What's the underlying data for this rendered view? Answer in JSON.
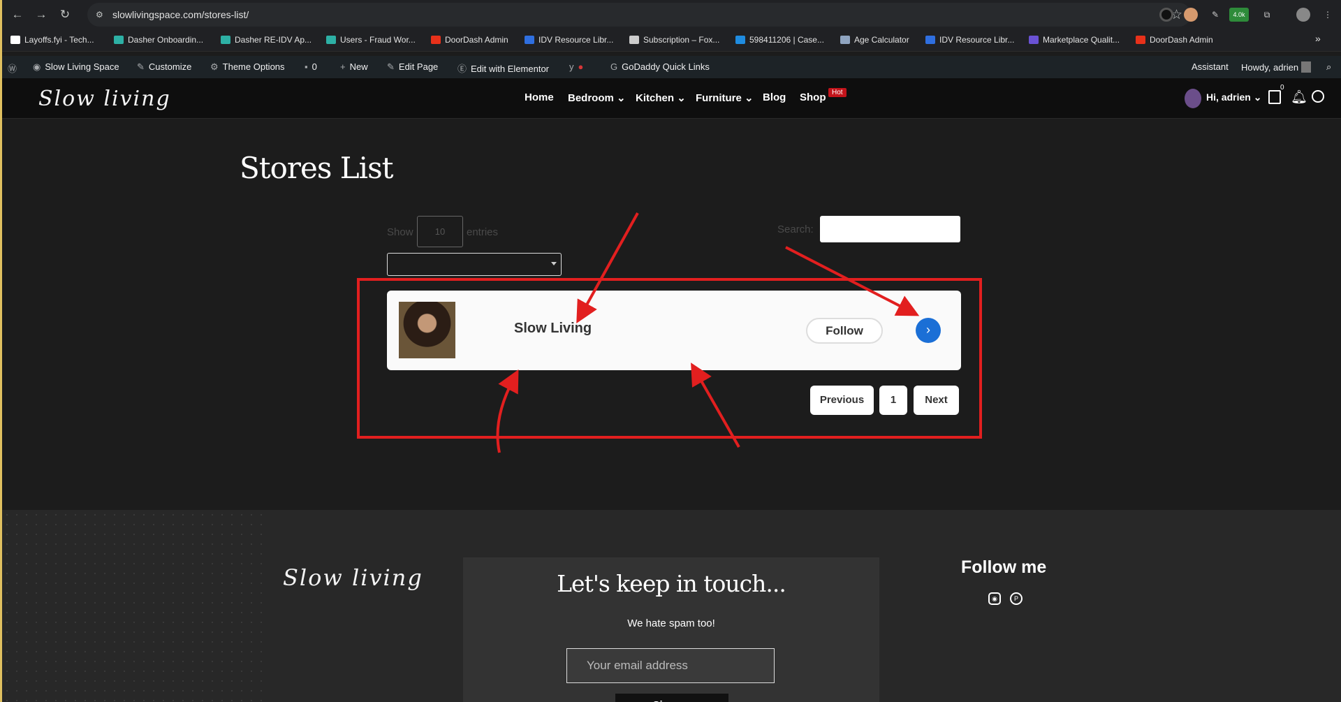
{
  "browser": {
    "url": "slowlivingspace.com/stores-list/",
    "extension_badge": "4.0k"
  },
  "bookmarks": [
    {
      "label": "Layoffs.fyi - Tech...",
      "color": "#ffffff"
    },
    {
      "label": "Dasher Onboardin...",
      "color": "#2db0a5"
    },
    {
      "label": "Dasher RE-IDV Ap...",
      "color": "#2db0a5"
    },
    {
      "label": "Users - Fraud Wor...",
      "color": "#2db0a5"
    },
    {
      "label": "DoorDash Admin",
      "color": "#e8311a"
    },
    {
      "label": "IDV Resource Libr...",
      "color": "#2f6fe0"
    },
    {
      "label": "Subscription – Fox...",
      "color": "#cccccc"
    },
    {
      "label": "598411206 | Case...",
      "color": "#1f8ce0"
    },
    {
      "label": "Age Calculator",
      "color": "#8fa4c0"
    },
    {
      "label": "IDV Resource Libr...",
      "color": "#2f6fe0"
    },
    {
      "label": "Marketplace Qualit...",
      "color": "#6a52d4"
    },
    {
      "label": "DoorDash Admin",
      "color": "#e8311a"
    }
  ],
  "wp_admin_bar": {
    "site": "Slow Living Space",
    "customize": "Customize",
    "theme_options": "Theme Options",
    "comments": "0",
    "new": "New",
    "edit_page": "Edit Page",
    "edit_elementor": "Edit with Elementor",
    "godaddy": "GoDaddy Quick Links",
    "assistant": "Assistant",
    "howdy": "Howdy, adrien"
  },
  "site_header": {
    "logo": "Slow living",
    "menu": [
      "Home",
      "Bedroom",
      "Kitchen",
      "Furniture",
      "Blog",
      "Shop"
    ],
    "hot_badge": "Hot",
    "greeting_prefix": "Hi, ",
    "greeting_name": "adrien",
    "cart_count": "0"
  },
  "page": {
    "title": "Stores List",
    "show_label": "Show",
    "length_value": "10",
    "entries_label": "entries",
    "search_label": "Search:",
    "stores": [
      {
        "name": "Slow Living",
        "follow_label": "Follow"
      }
    ],
    "pagination": {
      "previous": "Previous",
      "current": "1",
      "next": "Next"
    }
  },
  "footer": {
    "logo": "Slow living",
    "newsletter_title": "Let's keep in touch...",
    "newsletter_sub": "We hate spam too!",
    "email_placeholder": "Your email address",
    "signup": "Sign up",
    "follow_me": "Follow me",
    "social": [
      "instagram-icon",
      "pinterest-icon"
    ]
  },
  "colors": {
    "accent_blue": "#1b6fd6",
    "annotation_red": "#e21f1f",
    "hot_red": "#c3141b"
  }
}
